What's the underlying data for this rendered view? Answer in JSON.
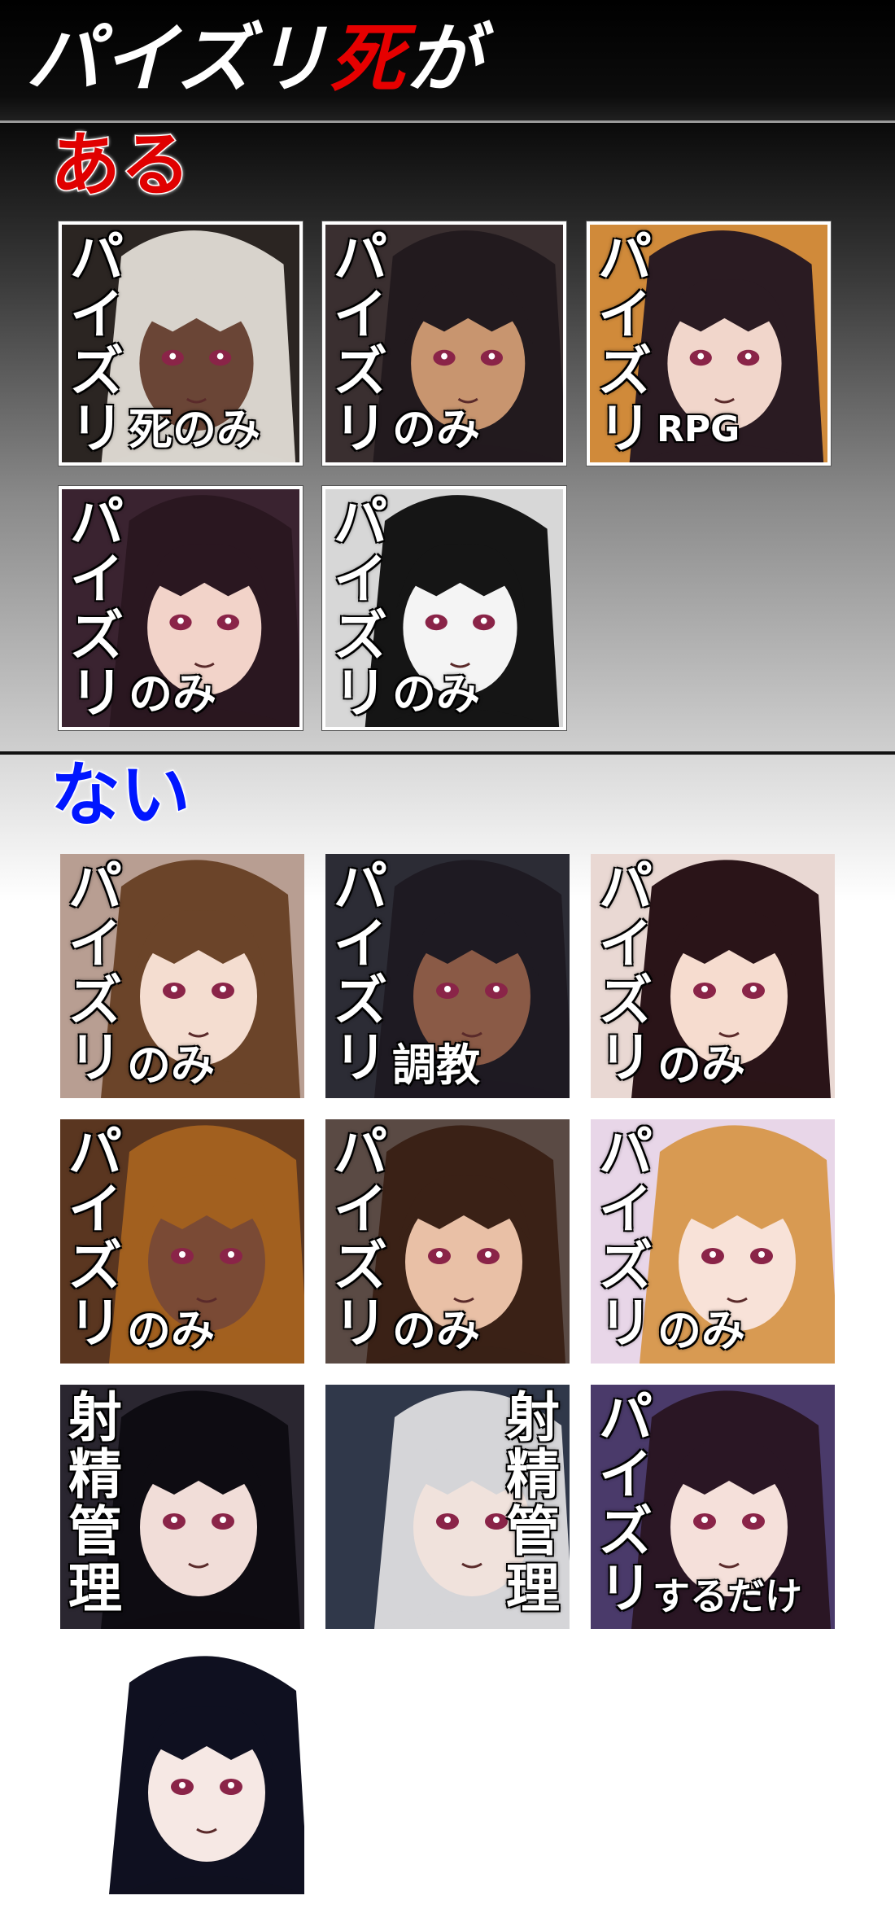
{
  "title": {
    "part1": "パイズリ",
    "part2": "死",
    "part3": "が"
  },
  "colors": {
    "accent_red": "#e60000",
    "heading_blue": "#0016ff"
  },
  "sections": [
    {
      "heading": "ある",
      "tiles": [
        {
          "vertical": [
            "パ",
            "イ",
            "ズ",
            "リ"
          ],
          "tail": "死のみ",
          "hair": "#d8d3cc",
          "skin": "#6a4536",
          "bg": "#2b2522"
        },
        {
          "vertical": [
            "パ",
            "イ",
            "ズ",
            "リ"
          ],
          "tail": "のみ",
          "hair": "#221a1e",
          "skin": "#c8956f",
          "bg": "#3a2f30"
        },
        {
          "vertical": [
            "パ",
            "イ",
            "ズ",
            "リ"
          ],
          "tail": "RPG",
          "hair": "#2a1b22",
          "skin": "#f1d6cb",
          "bg": "#d08a3a"
        },
        {
          "vertical": [
            "パ",
            "イ",
            "ズ",
            "リ"
          ],
          "tail": "のみ",
          "hair": "#2a1720",
          "skin": "#f2d3c9",
          "bg": "#3a2330"
        },
        {
          "vertical": [
            "パ",
            "イ",
            "ズ",
            "リ"
          ],
          "tail": "のみ",
          "hair": "#151515",
          "skin": "#f4f4f4",
          "bg": "#d7d7d7"
        }
      ]
    },
    {
      "heading": "ない",
      "tiles": [
        {
          "vertical": [
            "パ",
            "イ",
            "ズ",
            "リ"
          ],
          "tail": "のみ",
          "hair": "#6b4429",
          "skin": "#f4ddd0",
          "bg": "#b89e92"
        },
        {
          "vertical": [
            "パ",
            "イ",
            "ズ",
            "リ"
          ],
          "tail": "調教",
          "hair": "#1e1a22",
          "skin": "#8a5a46",
          "bg": "#2c2c35"
        },
        {
          "vertical": [
            "パ",
            "イ",
            "ズ",
            "リ"
          ],
          "tail": "のみ",
          "hair": "#2a1418",
          "skin": "#f6dccf",
          "bg": "#e9d8d3"
        },
        {
          "vertical": [
            "パ",
            "イ",
            "ズ",
            "リ"
          ],
          "tail": "のみ",
          "hair": "#a2601f",
          "skin": "#7a4a35",
          "bg": "#5a3620"
        },
        {
          "vertical": [
            "パ",
            "イ",
            "ズ",
            "リ"
          ],
          "tail": "のみ",
          "hair": "#3a2116",
          "skin": "#e9c0a6",
          "bg": "#5a4a44"
        },
        {
          "vertical": [
            "パ",
            "イ",
            "ズ",
            "リ"
          ],
          "tail": "のみ",
          "hair": "#d89a52",
          "skin": "#f8e2d8",
          "bg": "#e8d6e8"
        },
        {
          "vertical": [
            "射",
            "精",
            "管",
            "理"
          ],
          "tail": "",
          "hair": "#0e0c12",
          "skin": "#f1ddd8",
          "bg": "#2a2630"
        },
        {
          "vertical": [
            "射",
            "精",
            "管",
            "理"
          ],
          "tail": "",
          "hair": "#d5d5d8",
          "skin": "#f0e2dc",
          "bg": "#30384a"
        },
        {
          "vertical": [
            "パ",
            "イ",
            "ズ",
            "リ"
          ],
          "tail": "するだけ",
          "hair": "#2a1624",
          "skin": "#f5e0da",
          "bg": "#4a3a6a"
        },
        {
          "vertical": [],
          "tail": "",
          "hair": "#0f1020",
          "skin": "#f6e8e4",
          "bg": "#ffffff"
        }
      ]
    }
  ]
}
